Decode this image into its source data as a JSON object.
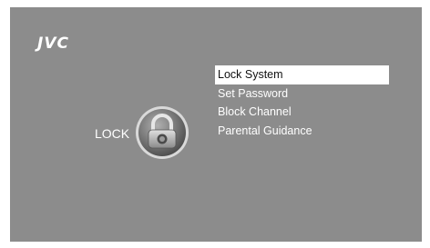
{
  "brand": {
    "logo_text": "JVC"
  },
  "section": {
    "label": "LOCK",
    "icon": "padlock-icon"
  },
  "menu": {
    "selected_index": 0,
    "items": [
      {
        "label": "Lock System"
      },
      {
        "label": "Set Password"
      },
      {
        "label": "Block Channel"
      },
      {
        "label": "Parental Guidance"
      }
    ]
  },
  "colors": {
    "background": "#8c8c8c",
    "text": "#ffffff",
    "highlight": "#ffffff",
    "highlight_text": "#111111"
  }
}
